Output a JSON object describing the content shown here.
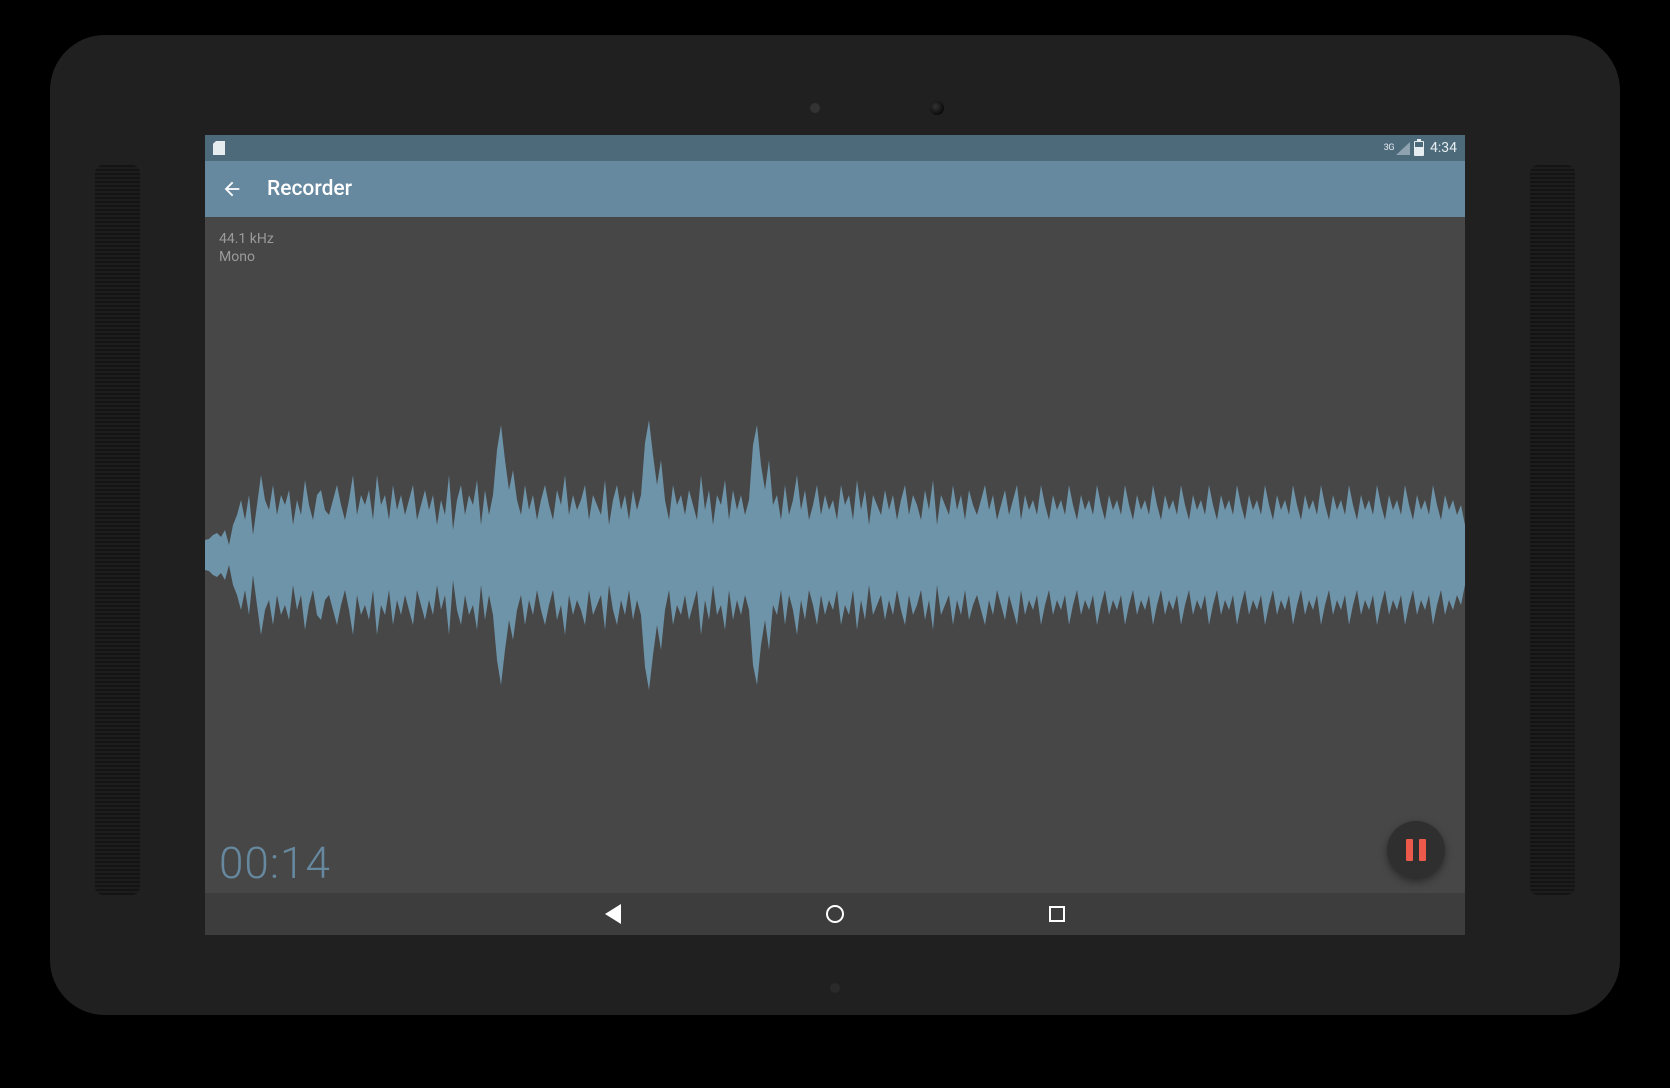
{
  "statusbar": {
    "network_label": "3G",
    "time": "4:34"
  },
  "actionbar": {
    "title": "Recorder"
  },
  "info": {
    "sample_rate": "44.1 kHz",
    "channels": "Mono"
  },
  "timer": {
    "elapsed": "00:14"
  },
  "colors": {
    "waveform": "#6e94aa",
    "accent_bar": "#6689a0",
    "pause_icon": "#ed5a4b"
  }
}
